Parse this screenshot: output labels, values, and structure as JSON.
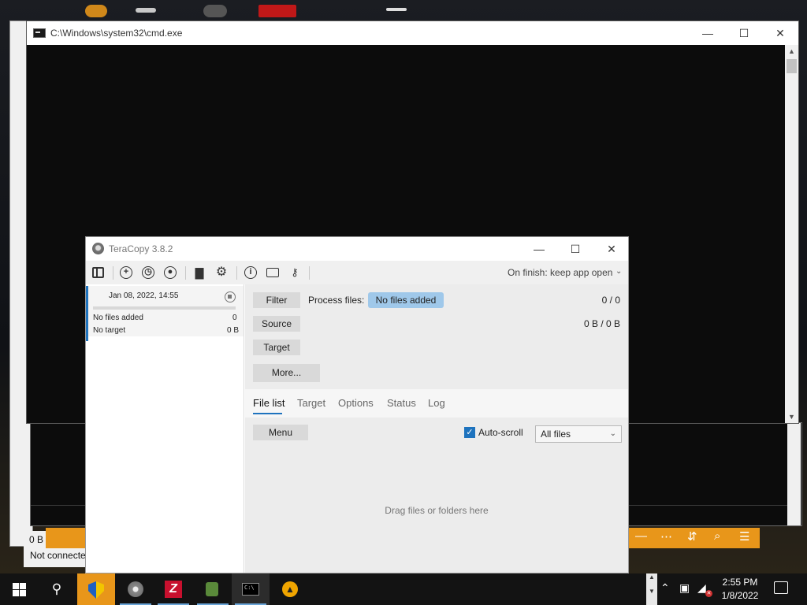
{
  "cmd": {
    "title": "C:\\Windows\\system32\\cmd.exe"
  },
  "background": {
    "status_size": "0 B",
    "status_conn": "Not connected"
  },
  "teracopy": {
    "title": "TeraCopy 3.8.2",
    "on_finish": "On finish: keep app open",
    "toolbar_icons": [
      "panel-icon",
      "add-icon",
      "history-icon",
      "account-icon",
      "print-icon",
      "gear-icon",
      "info-icon",
      "card-icon",
      "key-icon"
    ],
    "job": {
      "date": "Jan 08, 2022, 14:55",
      "progress": 0,
      "files_label": "No files added",
      "files_count": "0",
      "target_label": "No target",
      "target_size": "0 B"
    },
    "buttons": {
      "filter": "Filter",
      "source": "Source",
      "target": "Target",
      "more": "More...",
      "menu": "Menu"
    },
    "process_label": "Process files:",
    "process_badge": "No files added",
    "count_files": "0 / 0",
    "count_bytes": "0 B / 0 B",
    "tabs": [
      "File list",
      "Target",
      "Options",
      "Status",
      "Log"
    ],
    "active_tab": "File list",
    "autoscroll_label": "Auto-scroll",
    "autoscroll_checked": true,
    "filter_value": "All files",
    "drop_hint": "Drag files or folders here",
    "accent_color": "#1e73be",
    "badge_color": "#9fc8ea"
  },
  "taskbar": {
    "time": "2:55 PM",
    "date": "1/8/2022",
    "apps": [
      "shield-app",
      "teracopy-app",
      "filezilla-app",
      "vpn-app",
      "cmd-app",
      "warning-app"
    ]
  }
}
